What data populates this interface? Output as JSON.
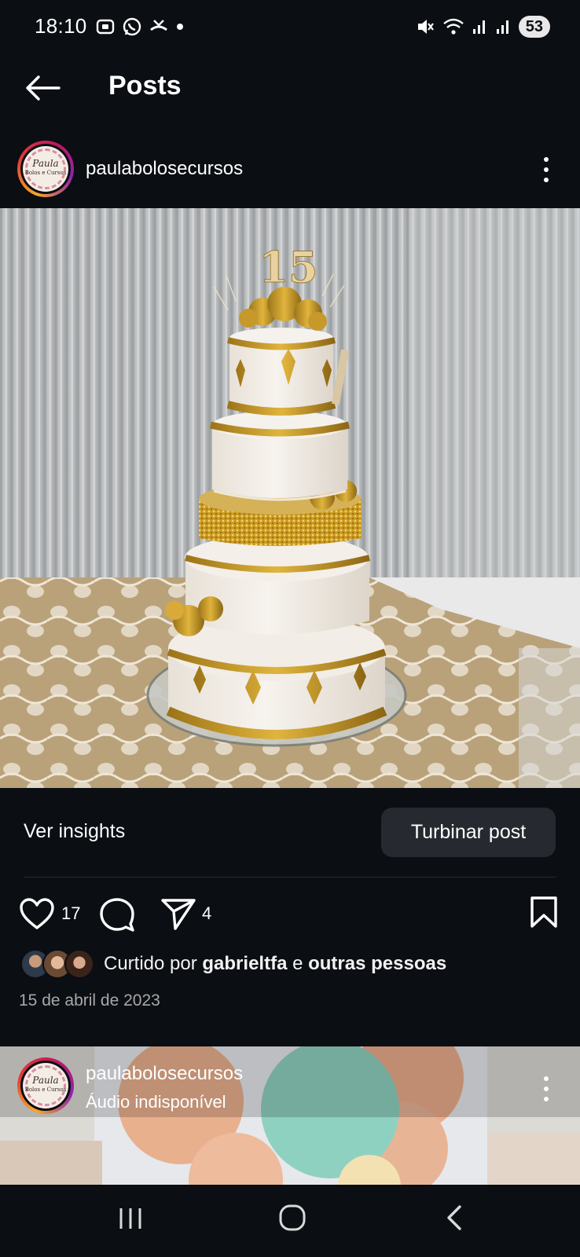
{
  "status_bar": {
    "time": "18:10",
    "battery": "53"
  },
  "top_bar": {
    "title": "Posts"
  },
  "post": {
    "username": "paulabolosecursos",
    "avatar_text": "Paula",
    "avatar_subtext": "Bolos e Cursos",
    "photo_topper": "15",
    "insights_label": "Ver insights",
    "boost_label": "Turbinar post",
    "like_count": "17",
    "share_count": "4",
    "liked_by_prefix": "Curtido por ",
    "liked_by_user": "gabrieltfa",
    "liked_by_middle": " e ",
    "liked_by_others": "outras pessoas",
    "date": "15 de abril de 2023"
  },
  "next_post": {
    "username": "paulabolosecursos",
    "audio_status": "Áudio indisponível"
  },
  "colors": {
    "background": "#0b0e13",
    "button_bg": "#262a30",
    "secondary_text": "#a8a8a8"
  }
}
